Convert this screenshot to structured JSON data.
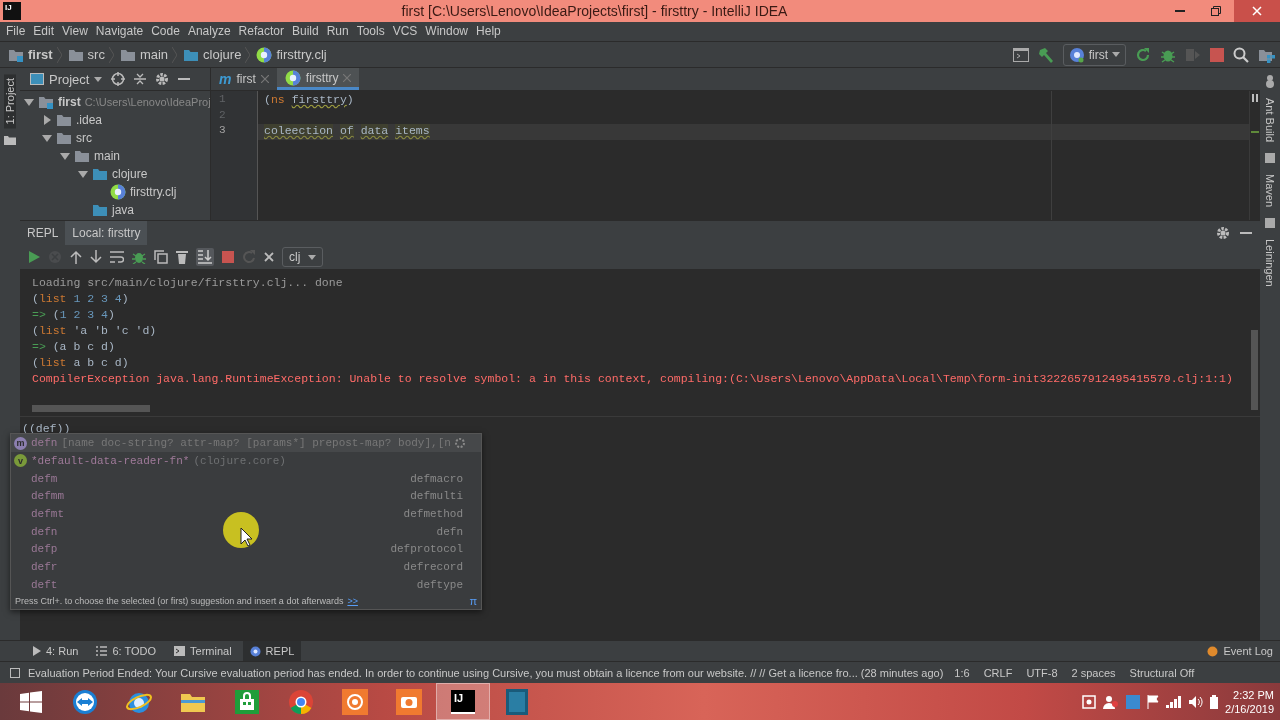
{
  "window": {
    "title": "first [C:\\Users\\Lenovo\\IdeaProjects\\first] - firsttry - IntelliJ IDEA",
    "app_badge": "IJ"
  },
  "menu": [
    "File",
    "Edit",
    "View",
    "Navigate",
    "Code",
    "Analyze",
    "Refactor",
    "Build",
    "Run",
    "Tools",
    "VCS",
    "Window",
    "Help"
  ],
  "breadcrumbs": [
    {
      "label": "first",
      "kind": "module"
    },
    {
      "label": "src",
      "kind": "folder"
    },
    {
      "label": "main",
      "kind": "folder"
    },
    {
      "label": "clojure",
      "kind": "source_folder"
    },
    {
      "label": "firsttry.clj",
      "kind": "clojure_file"
    }
  ],
  "run_config": {
    "label": "first"
  },
  "left_stripe": [
    "1: Project"
  ],
  "right_stripe": [
    "Ant Build",
    "Maven",
    "Leiningen"
  ],
  "project_panel": {
    "title": "Project",
    "tree": [
      {
        "label": "first",
        "kind": "module",
        "hint": "C:\\Users\\Lenovo\\IdeaProj",
        "expanded": true,
        "children": [
          {
            "label": ".idea",
            "kind": "folder",
            "expanded": false
          },
          {
            "label": "src",
            "kind": "folder",
            "expanded": true,
            "children": [
              {
                "label": "main",
                "kind": "folder",
                "expanded": true,
                "children": [
                  {
                    "label": "clojure",
                    "kind": "source_folder",
                    "expanded": true,
                    "children": [
                      {
                        "label": "firsttry.clj",
                        "kind": "clojure_file"
                      }
                    ]
                  },
                  {
                    "label": "java",
                    "kind": "source_folder"
                  }
                ]
              }
            ]
          }
        ]
      }
    ]
  },
  "editor": {
    "tabs": [
      {
        "label": "first",
        "badge": "m",
        "selected": false
      },
      {
        "label": "firsttry",
        "selected": true
      }
    ],
    "lines": [
      {
        "number": "1",
        "current": false,
        "tokens": [
          {
            "text": "(",
            "kind": "plain"
          },
          {
            "text": "ns",
            "kind": "keyword"
          },
          {
            "text": " firsttry",
            "kind": "warn"
          },
          {
            "text": ")",
            "kind": "plain"
          }
        ]
      },
      {
        "number": "2",
        "current": false
      },
      {
        "number": "3",
        "current": true,
        "tokens": [
          {
            "text": "coleection ",
            "kind": "unresolved"
          },
          {
            "text": "of ",
            "kind": "unresolved"
          },
          {
            "text": "data ",
            "kind": "unresolved"
          },
          {
            "text": "items",
            "kind": "unresolved"
          }
        ]
      }
    ]
  },
  "repl": {
    "tabs": [
      {
        "label": "REPL",
        "selected": false
      },
      {
        "label": "Local: firsttry",
        "selected": true
      }
    ],
    "dialect": "clj",
    "output": [
      {
        "tokens": [
          {
            "text": "Loading src/main/clojure/firsttry.clj... done",
            "kind": "info"
          }
        ]
      },
      {
        "tokens": [
          {
            "text": "(",
            "kind": "plain"
          },
          {
            "text": "list",
            "kind": "keyword"
          },
          {
            "text": " 1 2 3 4",
            "kind": "number"
          },
          {
            "text": ")",
            "kind": "plain"
          }
        ]
      },
      {
        "tokens": [
          {
            "text": "=>",
            "kind": "arrow"
          },
          {
            "text": " (",
            "kind": "plain"
          },
          {
            "text": "1 2 3 4",
            "kind": "number"
          },
          {
            "text": ")",
            "kind": "plain"
          }
        ]
      },
      {
        "tokens": [
          {
            "text": "(",
            "kind": "plain"
          },
          {
            "text": "list",
            "kind": "keyword"
          },
          {
            "text": " 'a 'b 'c 'd)",
            "kind": "plain"
          }
        ]
      },
      {
        "tokens": [
          {
            "text": "=>",
            "kind": "arrow"
          },
          {
            "text": " (a b c d)",
            "kind": "plain"
          }
        ]
      },
      {
        "tokens": [
          {
            "text": "(",
            "kind": "plain"
          },
          {
            "text": "list",
            "kind": "keyword"
          },
          {
            "text": " a b c d)",
            "kind": "plain"
          }
        ]
      },
      {
        "tokens": [
          {
            "text": "CompilerException java.lang.RuntimeException: Unable to resolve symbol: a in this context, compiling:(C:\\Users\\Lenovo\\AppData\\Local\\Temp\\form-init3222657912495415579.clj:1:1)",
            "kind": "error"
          }
        ]
      }
    ],
    "input": "((def))",
    "completion": {
      "items": [
        {
          "kind": "symbol",
          "badge": "m",
          "name": "defn",
          "detail": "[name doc-string? attr-map? [params*] prepost-map? body],[n",
          "selected": true
        },
        {
          "kind": "symbol",
          "badge": "v",
          "name": "*default-data-reader-fn*",
          "detail": "(clojure.core)",
          "selected": false
        },
        {
          "kind": "template",
          "name": "defm",
          "detail": "defmacro",
          "selected": false
        },
        {
          "kind": "template",
          "name": "defmm",
          "detail": "defmulti",
          "selected": false
        },
        {
          "kind": "template",
          "name": "defmt",
          "detail": "defmethod",
          "selected": false
        },
        {
          "kind": "template",
          "name": "defn",
          "detail": "defn",
          "selected": false
        },
        {
          "kind": "template",
          "name": "defp",
          "detail": "defprotocol",
          "selected": false
        },
        {
          "kind": "template",
          "name": "defr",
          "detail": "defrecord",
          "selected": false
        },
        {
          "kind": "template",
          "name": "deft",
          "detail": "deftype",
          "selected": false
        }
      ],
      "hint": "Press Ctrl+. to choose the selected (or first) suggestion and insert a dot afterwards",
      "hint_link": ">>",
      "corner": "π"
    }
  },
  "tool_windows": [
    {
      "label": "4: Run",
      "kind": "run",
      "selected": false
    },
    {
      "label": "6: TODO",
      "kind": "todo",
      "selected": false
    },
    {
      "label": "Terminal",
      "kind": "terminal",
      "selected": false
    },
    {
      "label": "REPL",
      "kind": "repl",
      "selected": true
    }
  ],
  "event_log": "Event Log",
  "status_bar": {
    "message": "Evaluation Period Ended: Your Cursive evaluation period has ended. In order to continue using Cursive, you must obtain a licence from our website. // // Get a licence fro... (28 minutes ago)",
    "items": [
      "1:6",
      "CRLF",
      "UTF-8",
      "2 spaces",
      "Structural Off"
    ]
  },
  "taskbar": {
    "apps": [
      {
        "kind": "remote",
        "selected": false
      },
      {
        "kind": "browser_e",
        "selected": false
      },
      {
        "kind": "explorer",
        "selected": false
      },
      {
        "kind": "store",
        "selected": false
      },
      {
        "kind": "browser_c",
        "selected": false
      },
      {
        "kind": "recorder",
        "selected": false
      },
      {
        "kind": "camera",
        "selected": false
      },
      {
        "kind": "ide",
        "label": "IJ",
        "selected": true
      },
      {
        "kind": "window",
        "selected": false
      }
    ],
    "time": "2:32 PM",
    "date": "2/16/2019"
  }
}
